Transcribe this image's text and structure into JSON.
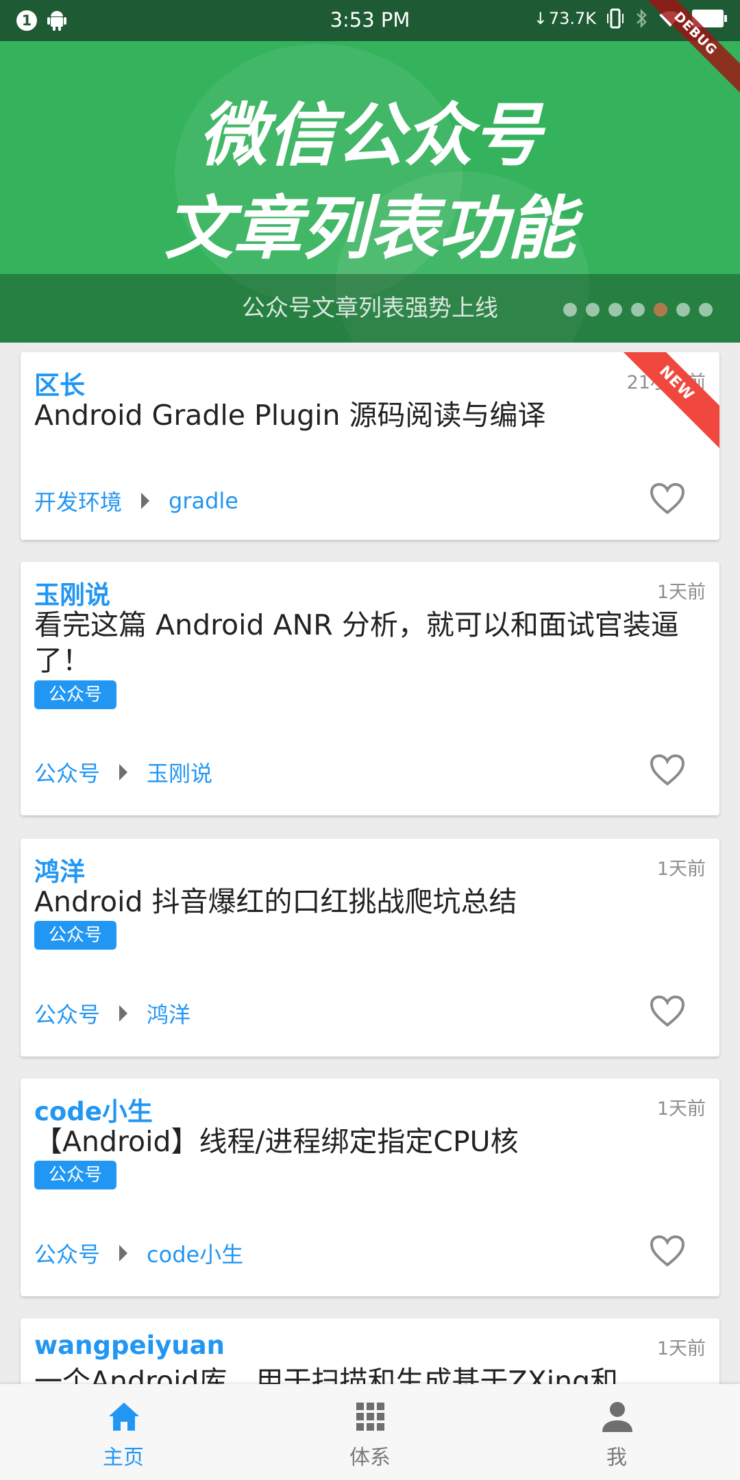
{
  "status_bar": {
    "notification_count": "1",
    "time": "3:53 PM",
    "net_speed": "73.7K"
  },
  "debug_ribbon": "DEBUG",
  "banner": {
    "title_line1": "微信公众号",
    "title_line2": "文章列表功能",
    "caption": "公众号文章列表强势上线",
    "dot_count": 7,
    "active_dot": 5
  },
  "articles": [
    {
      "author": "区长",
      "time": "21小时前",
      "title": "Android Gradle Plugin 源码阅读与编译",
      "tag": "",
      "chapter": "开发环境",
      "subchapter": "gradle",
      "ribbon": "NEW"
    },
    {
      "author": "玉刚说",
      "time": "1天前",
      "title": "看完这篇 Android ANR 分析，就可以和面试官装逼了！",
      "tag": "公众号",
      "chapter": "公众号",
      "subchapter": "玉刚说"
    },
    {
      "author": "鸿洋",
      "time": "1天前",
      "title": "Android 抖音爆红的口红挑战爬坑总结",
      "tag": "公众号",
      "chapter": "公众号",
      "subchapter": "鸿洋"
    },
    {
      "author": "code小生",
      "time": "1天前",
      "title": "【Android】线程/进程绑定指定CPU核",
      "tag": "公众号",
      "chapter": "公众号",
      "subchapter": "code小生"
    },
    {
      "author": "wangpeiyuan",
      "time": "1天前",
      "title": "一个Android库，用于扫描和生成基于ZXing和"
    }
  ],
  "bottom_nav": [
    {
      "label": "主页",
      "icon": "home-icon",
      "active": true
    },
    {
      "label": "体系",
      "icon": "grid-icon",
      "active": false
    },
    {
      "label": "我",
      "icon": "person-icon",
      "active": false
    }
  ],
  "colors": {
    "accent": "#2196f3",
    "banner_green": "#34b25c",
    "status_bar": "#1e5a33",
    "new_ribbon": "#f0483e"
  }
}
